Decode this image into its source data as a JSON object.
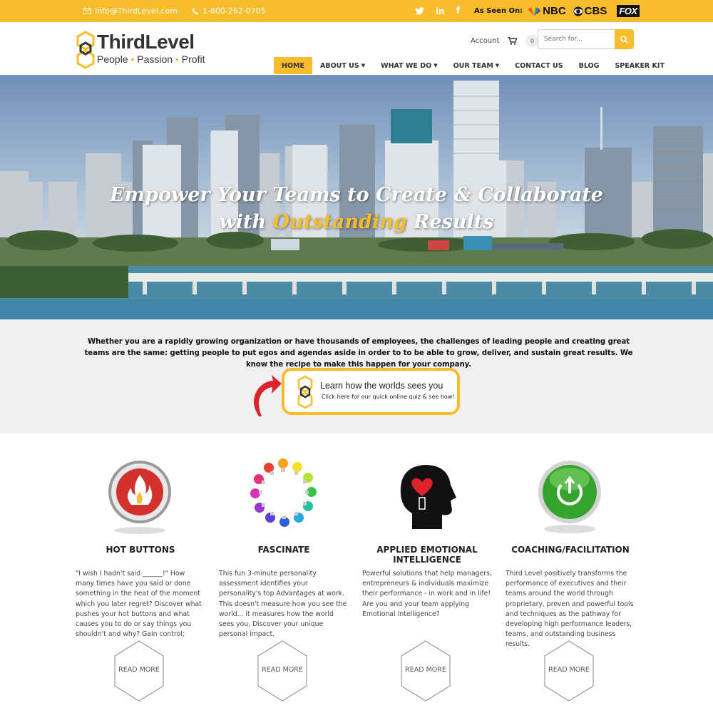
{
  "topbar": {
    "email": "Info@ThirdLevel.com",
    "phone": "1-800-262-0705",
    "as_seen_on": "As Seen On:",
    "media": [
      "NBC",
      "CBS",
      "FOX"
    ]
  },
  "brand": {
    "name": "ThirdLevel",
    "tagline": [
      "People",
      "Passion",
      "Profit"
    ]
  },
  "utility": {
    "account": "Account",
    "cart_count": "0",
    "search_placeholder": "Search for..."
  },
  "nav": [
    {
      "label": "HOME",
      "active": true,
      "dropdown": false
    },
    {
      "label": "ABOUT US",
      "active": false,
      "dropdown": true
    },
    {
      "label": "WHAT WE DO",
      "active": false,
      "dropdown": true
    },
    {
      "label": "OUR TEAM",
      "active": false,
      "dropdown": true
    },
    {
      "label": "CONTACT US",
      "active": false,
      "dropdown": false
    },
    {
      "label": "BLOG",
      "active": false,
      "dropdown": false
    },
    {
      "label": "SPEAKER KIT",
      "active": false,
      "dropdown": false
    }
  ],
  "hero": {
    "line1": "Empower Your Teams to Create & Collaborate",
    "line2_pre": "with",
    "line2_highlight": "Outstanding",
    "line2_post": "Results"
  },
  "intro": {
    "text": "Whether you are a rapidly growing organization or have thousands of employees, the challenges of leading people and creating great teams are the same: getting people to put egos and agendas aside in order to to be able to grow, deliver, and sustain great results. We know the recipe to make this happen for your company.",
    "quiz_title": "Learn how the worlds sees you",
    "quiz_sub": "Click here for our quick online quiz & see how!"
  },
  "cards": [
    {
      "title": "HOT BUTTONS",
      "text": "\"I wish I hadn't said ______!\" How many times have you said or done something in the heat of the moment which you later regret? Discover what pushes your hot buttons and what causes you to do or say things you shouldn't and why? Gain control;",
      "more": "READ MORE",
      "icon": "flame-button-icon"
    },
    {
      "title": "FASCINATE",
      "text": "This fun 3-minute personality assessment identifies your personality's top Advantages at work. This doesn't measure how you see the world... it measures how the world sees you. Discover your unique personal impact.",
      "more": "READ MORE",
      "icon": "lightbulb-circle-icon"
    },
    {
      "title": "APPLIED EMOTIONAL INTELLIGENCE",
      "text": "Powerful solutions that help managers, entrepreneurs & individuals maximize their performance - in work and in life! Are you and your team applying Emotional Intelligence?",
      "more": "READ MORE",
      "icon": "head-heart-icon"
    },
    {
      "title": "COACHING/FACILITATION",
      "text": "Third Level positively transforms the performance of executives and their teams around the world through proprietary, proven and powerful tools and techniques as the pathway for developing high performance leaders, teams, and outstanding business results.",
      "more": "READ MORE",
      "icon": "green-power-button-icon"
    }
  ],
  "colors": {
    "accent": "#f7bd2c",
    "text": "#333333",
    "band": "#f0f0f0"
  }
}
